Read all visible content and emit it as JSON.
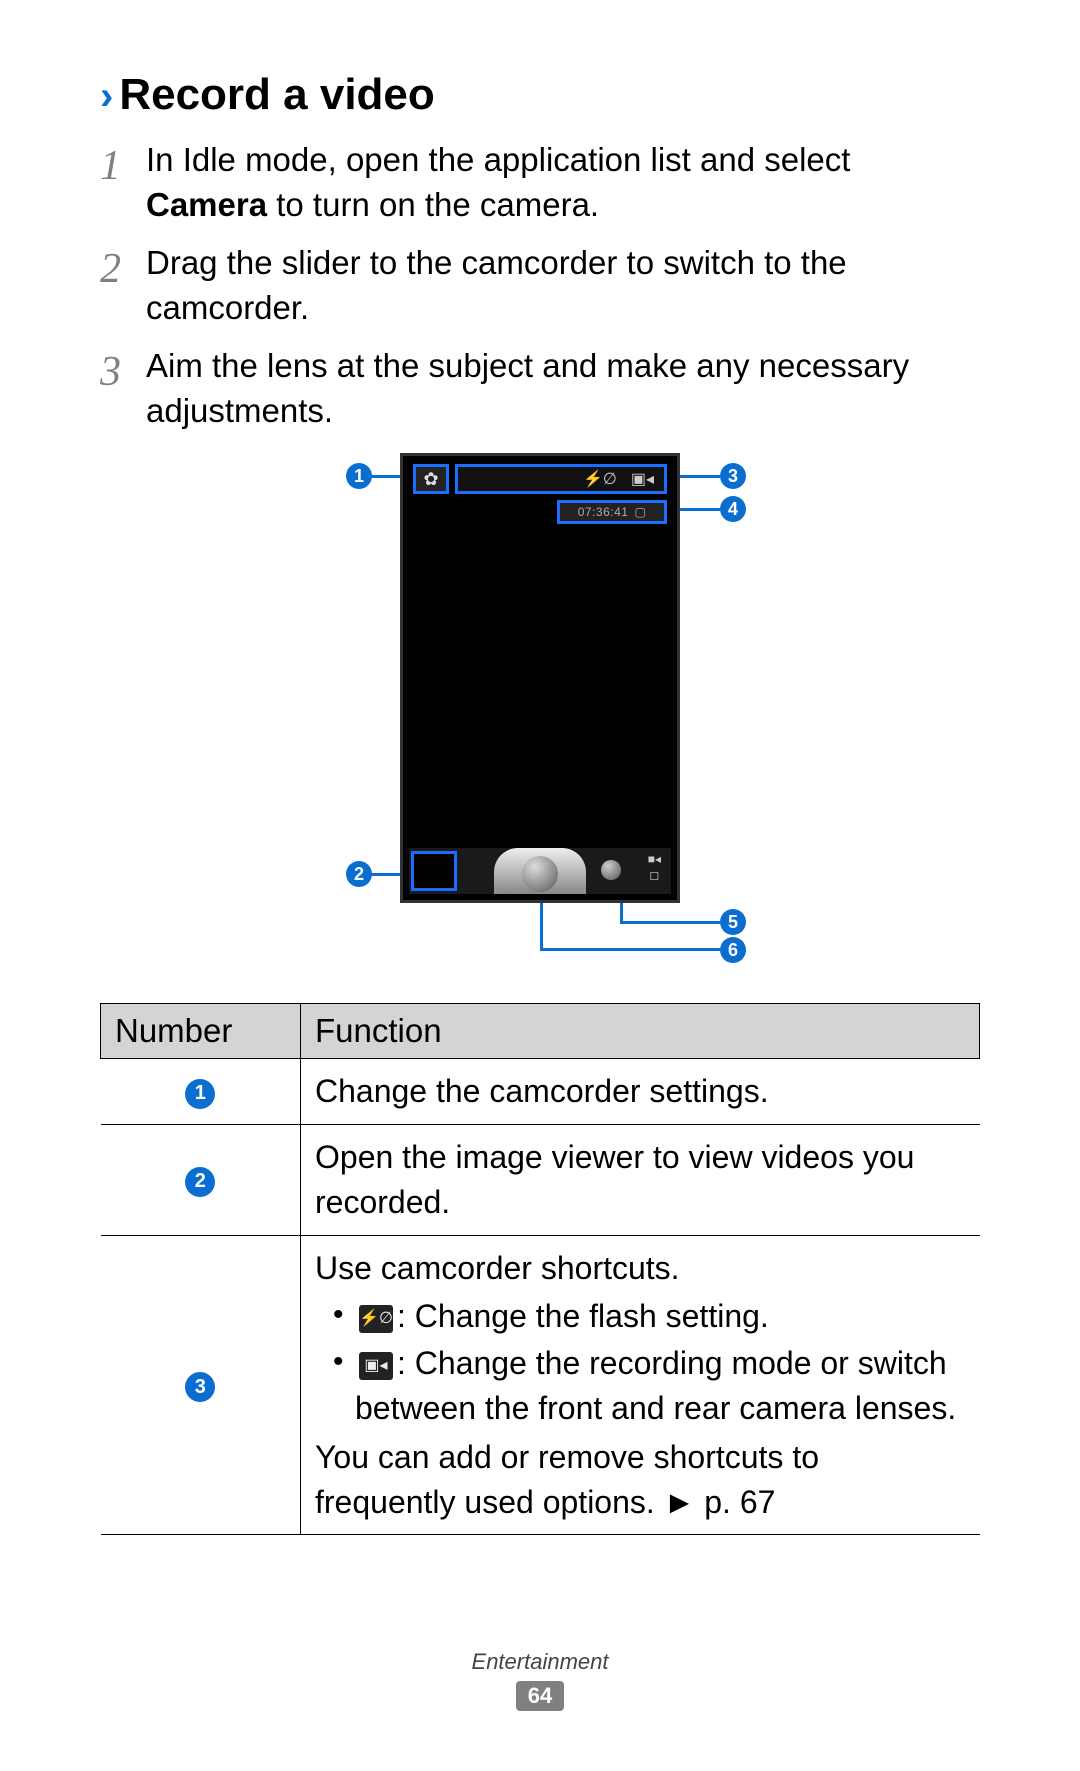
{
  "heading": "Record a video",
  "steps": [
    {
      "num": "1",
      "pre": "In Idle mode, open the application list and select ",
      "bold": "Camera",
      "post": " to turn on the camera."
    },
    {
      "num": "2",
      "pre": "Drag the slider to the camcorder to switch to the camcorder.",
      "bold": "",
      "post": ""
    },
    {
      "num": "3",
      "pre": "Aim the lens at the subject and make any necessary adjustments.",
      "bold": "",
      "post": ""
    }
  ],
  "diagram": {
    "timer": "07:36:41",
    "callouts": {
      "c1": "1",
      "c2": "2",
      "c3": "3",
      "c4": "4",
      "c5": "5",
      "c6": "6"
    }
  },
  "table": {
    "head_number": "Number",
    "head_function": "Function",
    "rows": {
      "r1": {
        "num": "1",
        "text": "Change the camcorder settings."
      },
      "r2": {
        "num": "2",
        "text": "Open the image viewer to view videos you recorded."
      },
      "r3": {
        "num": "3",
        "intro": "Use camcorder shortcuts.",
        "b1": ": Change the flash setting.",
        "b2": ": Change the recording mode or switch between the front and rear camera lenses.",
        "outro_a": "You can add or remove shortcuts to frequently used options. ",
        "outro_b": "►",
        "outro_c": " p. 67"
      }
    }
  },
  "footer": {
    "category": "Entertainment",
    "page": "64"
  }
}
